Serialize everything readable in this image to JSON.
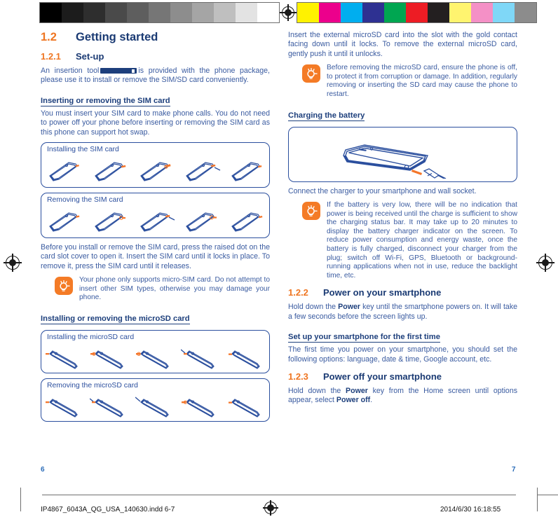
{
  "calibration": {
    "grayscale_patches": [
      "#000000",
      "#1c1c1c",
      "#2e2e2e",
      "#4a4a4a",
      "#5e5e5e",
      "#767676",
      "#8d8d8d",
      "#a5a5a5",
      "#bfbfbf",
      "#e3e3e3",
      "#ffffff"
    ],
    "color_patches": [
      "#fff200",
      "#ec008c",
      "#00aeef",
      "#2e3192",
      "#00a651",
      "#ed1c24",
      "#231f20",
      "#fff46f",
      "#f490c6",
      "#7fd7f7",
      "#8c8c8c"
    ],
    "registration_mark": "registration-target-icon"
  },
  "left_column": {
    "section": {
      "number": "1.2",
      "title": "Getting started"
    },
    "subsection": {
      "number": "1.2.1",
      "title": "Set-up"
    },
    "intro_before_tool": "An insertion tool",
    "intro_after_tool": "is provided with the phone package, please use it to install or remove the SIM/SD card conveniently.",
    "sim_heading": "Inserting or removing the SIM card",
    "sim_paragraph": "You must insert your SIM card to make phone calls. You do not need to power off your phone before inserting or removing the SIM card as this phone can support hot swap.",
    "illo_sim_install_label": "Installing the SIM card",
    "illo_sim_remove_label": "Removing the SIM card",
    "sim_instructions": "Before you install or remove the SIM card, press the raised dot on the card slot cover to open it. Insert the SIM card until it locks in place. To remove it, press the SIM card until it releases.",
    "tip_sim": "Your phone only supports micro-SIM card. Do not attempt to insert other SIM types, otherwise you may damage your phone.",
    "microsd_heading": "Installing or removing the microSD card",
    "illo_sd_install_label": "Installing the microSD card",
    "illo_sd_remove_label": "Removing the microSD card"
  },
  "right_column": {
    "microsd_paragraph": "Insert the external microSD card into the slot with the gold contact facing down until it locks. To remove the external microSD card, gently push it until it unlocks.",
    "tip_microsd": "Before removing the microSD card, ensure the phone is off, to protect it from corruption or damage. In addition, regularly removing or inserting the SD card may cause the phone to restart.",
    "charging_heading": "Charging the battery",
    "charging_caption": "Connect the charger to your smartphone and wall socket.",
    "tip_battery": "If the battery is very low, there will be no indication that power is being received until the charge is sufficient to show the charging status bar.  It may take up to 20 minutes to display the battery charger indicator on the screen. To reduce power consumption and energy waste, once the battery is fully charged, disconnect your charger from the plug; switch off Wi-Fi, GPS, Bluetooth or background-running applications when not in use, reduce the backlight time, etc.",
    "power_on": {
      "number": "1.2.2",
      "title": "Power on your smartphone",
      "paragraph_1": "Hold down the ",
      "paragraph_1_bold": "Power",
      "paragraph_1_rest": " key until the smartphone powers on. It will take a few seconds before the screen lights up.",
      "first_time_heading": "Set up your smartphone for the first time",
      "first_time_paragraph": "The first time you power on your smartphone, you should set the following options: language, date & time, Google account, etc."
    },
    "power_off": {
      "number": "1.2.3",
      "title": "Power off your smartphone",
      "paragraph_start": "Hold down the ",
      "bold_1": "Power",
      "paragraph_mid": " key from the Home screen until options appear, select ",
      "bold_2": "Power off",
      "paragraph_end": "."
    }
  },
  "footer": {
    "page_left": "6",
    "page_right": "7",
    "file_name": "IP4867_6043A_QG_USA_140630.indd   6-7",
    "timestamp": "2014/6/30   16:18:55"
  },
  "colors": {
    "orange_accent": "#ef7622",
    "heading_navy": "#1a3a73",
    "body_blue": "#3a5ba0",
    "box_border": "#2b4f9e",
    "tip_orange": "#f47b26"
  }
}
